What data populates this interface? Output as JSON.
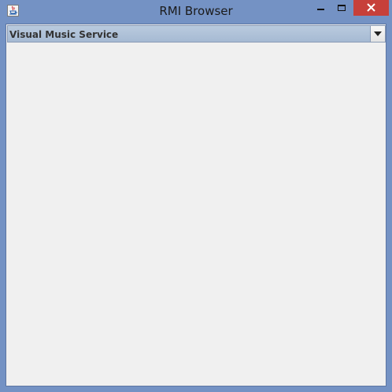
{
  "window": {
    "title": "RMI Browser",
    "icon": "java-icon"
  },
  "controls": {
    "minimize_icon": "minimize-icon",
    "maximize_icon": "maximize-icon",
    "close_icon": "close-icon",
    "close_color": "#c7403a"
  },
  "service_selector": {
    "selected": "Visual Music Service",
    "arrow_icon": "chevron-down-icon"
  },
  "colors": {
    "frame": "#7492c4",
    "content_bg": "#f0f0f0"
  }
}
